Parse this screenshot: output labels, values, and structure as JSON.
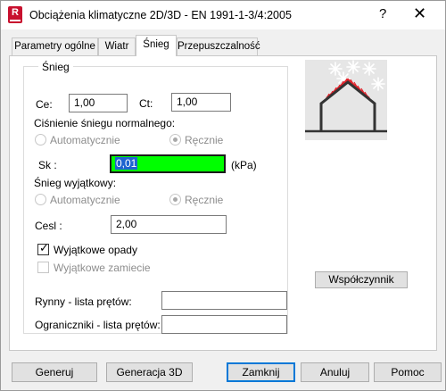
{
  "window": {
    "title": "Obciążenia klimatyczne 2D/3D - EN 1991-1-3/4:2005",
    "app_icon_letter": "R",
    "help_glyph": "?",
    "close_glyph": "✕"
  },
  "tabs": [
    {
      "label": "Parametry ogólne"
    },
    {
      "label": "Wiatr"
    },
    {
      "label": "Śnieg",
      "active": true
    },
    {
      "label": "Przepuszczalność"
    }
  ],
  "snow_group": {
    "legend": "Śnieg",
    "ce": {
      "label": "Ce:",
      "value": "1,00"
    },
    "ct": {
      "label": "Ct:",
      "value": "1,00"
    },
    "normal_pressure_label": "Ciśnienie śniegu normalnego:",
    "normal_auto": "Automatycznie",
    "normal_manual": "Ręcznie",
    "sk": {
      "label": "Sk :",
      "value": "0,01",
      "unit": "(kPa)"
    },
    "exceptional_label": "Śnieg wyjątkowy:",
    "exc_auto": "Automatycznie",
    "exc_manual": "Ręcznie",
    "cesl": {
      "label": "Cesl :",
      "value": "2,00"
    },
    "exceptional_falls": {
      "label": "Wyjątkowe opady",
      "checked": true
    },
    "exceptional_drifts": {
      "label": "Wyjątkowe zamiecie",
      "checked": false
    }
  },
  "coefficient_button": "Współczynnik",
  "gutters": {
    "label": "Rynny - lista prętów:",
    "value": ""
  },
  "limiters": {
    "label": "Ograniczniki - lista prętów:",
    "value": ""
  },
  "footer": {
    "generate": "Generuj",
    "generate_3d": "Generacja 3D",
    "close": "Zamknij",
    "cancel": "Anuluj",
    "help": "Pomoc"
  },
  "colors": {
    "highlight_field": "#00ff00",
    "snow_load": "#e0242c",
    "accent": "#0078d7"
  }
}
